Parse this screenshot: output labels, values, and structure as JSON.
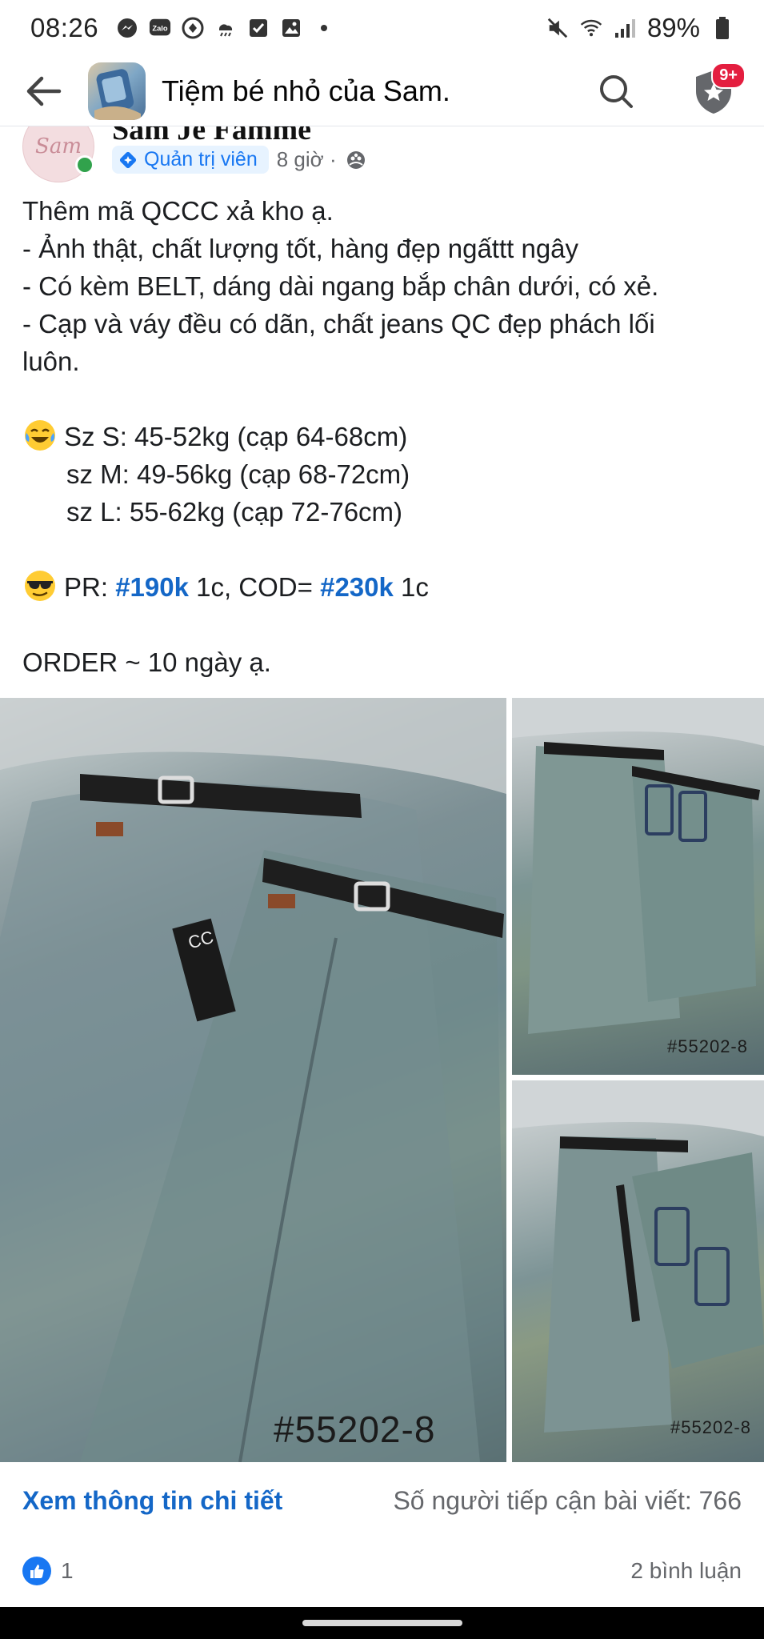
{
  "status_bar": {
    "time": "08:26",
    "battery": "89%",
    "icons": [
      "messenger-icon",
      "zalo-icon",
      "notification-app-icon",
      "weather-icon",
      "checkbox-icon",
      "gallery-icon",
      "more-dot-icon"
    ],
    "right_icons": [
      "mute-icon",
      "wifi-icon",
      "signal-icon",
      "battery-icon"
    ],
    "zalo_label": "Zalo"
  },
  "app_bar": {
    "title": "Tiệm bé nhỏ của Sam.",
    "badge": "9+"
  },
  "post": {
    "author_cut": "Sam Je Famme",
    "avatar_text": "Sam",
    "role": "Quản trị viên",
    "time": "8 giờ ·",
    "lines": {
      "l1": "Thêm mã QCCC xả kho ạ.",
      "l2": "- Ảnh thật, chất lượng tốt, hàng đẹp ngấttt ngây",
      "l3": "- Có kèm BELT, dáng dài ngang bắp chân dưới, có xẻ.",
      "l4": "- Cạp và váy đều có dãn, chất jeans QC đẹp phách lối",
      "l5": "luôn.",
      "l6": "Sz S: 45-52kg (cạp 64-68cm)",
      "l7": "sz M: 49-56kg (cạp 68-72cm)",
      "l8": "sz L: 55-62kg (cạp 72-76cm)",
      "l9_prefix": "PR: ",
      "l9_tag1": "#190k",
      "l9_mid": " 1c, COD= ",
      "l9_tag2": "#230k",
      "l9_suffix": " 1c",
      "l10": "ORDER ~ 10 ngày ạ."
    }
  },
  "photos": {
    "main_code": "#55202-8",
    "top_right_code": "#55202-8",
    "bottom_right_code": "#55202-8",
    "main_tag_text": "CC"
  },
  "footer": {
    "detail_link": "Xem thông tin chi tiết",
    "reach": "Số người tiếp cận bài viết: 766",
    "like_count": "1",
    "comments": "2 bình luận"
  },
  "colors": {
    "accent": "#1877f2",
    "hashtag": "#1467c7",
    "online": "#31a24c",
    "badge": "#e41e3f"
  }
}
